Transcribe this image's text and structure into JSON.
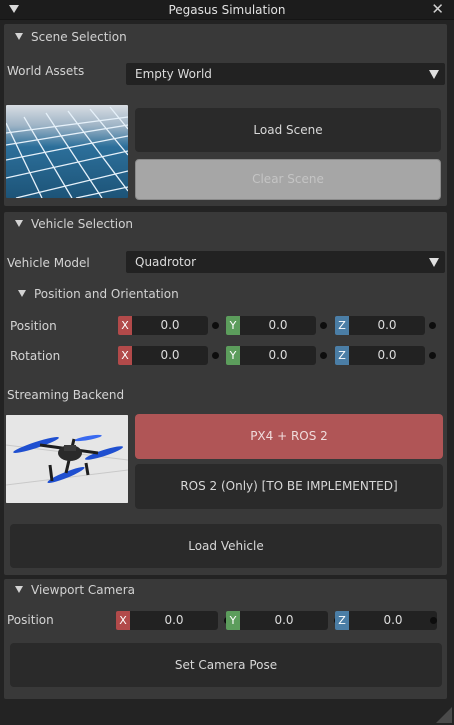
{
  "window": {
    "title": "Pegasus Simulation",
    "close_glyph": "✕"
  },
  "scene": {
    "header": "Scene Selection",
    "world_assets_label": "World Assets",
    "world_assets_value": "Empty World",
    "load_button": "Load Scene",
    "clear_button": "Clear Scene"
  },
  "vehicle": {
    "header": "Vehicle Selection",
    "model_label": "Vehicle Model",
    "model_value": "Quadrotor",
    "pose_header": "Position and Orientation",
    "position_label": "Position",
    "rotation_label": "Rotation",
    "position": {
      "x": "0.0",
      "y": "0.0",
      "z": "0.0"
    },
    "rotation": {
      "x": "0.0",
      "y": "0.0",
      "z": "0.0"
    },
    "streaming_label": "Streaming Backend",
    "backend_px4": "PX4 + ROS 2",
    "backend_ros2": "ROS 2 (Only) [TO BE IMPLEMENTED]",
    "load_button": "Load Vehicle"
  },
  "camera": {
    "header": "Viewport Camera",
    "position_label": "Position",
    "position": {
      "x": "0.0",
      "y": "0.0",
      "z": "0.0"
    },
    "set_button": "Set Camera Pose"
  },
  "axis_labels": {
    "x": "X",
    "y": "Y",
    "z": "Z"
  },
  "colors": {
    "x_axis": "#b24a4a",
    "y_axis": "#5c9d5c",
    "z_axis": "#4b7ea6",
    "active_backend": "#b05556"
  }
}
